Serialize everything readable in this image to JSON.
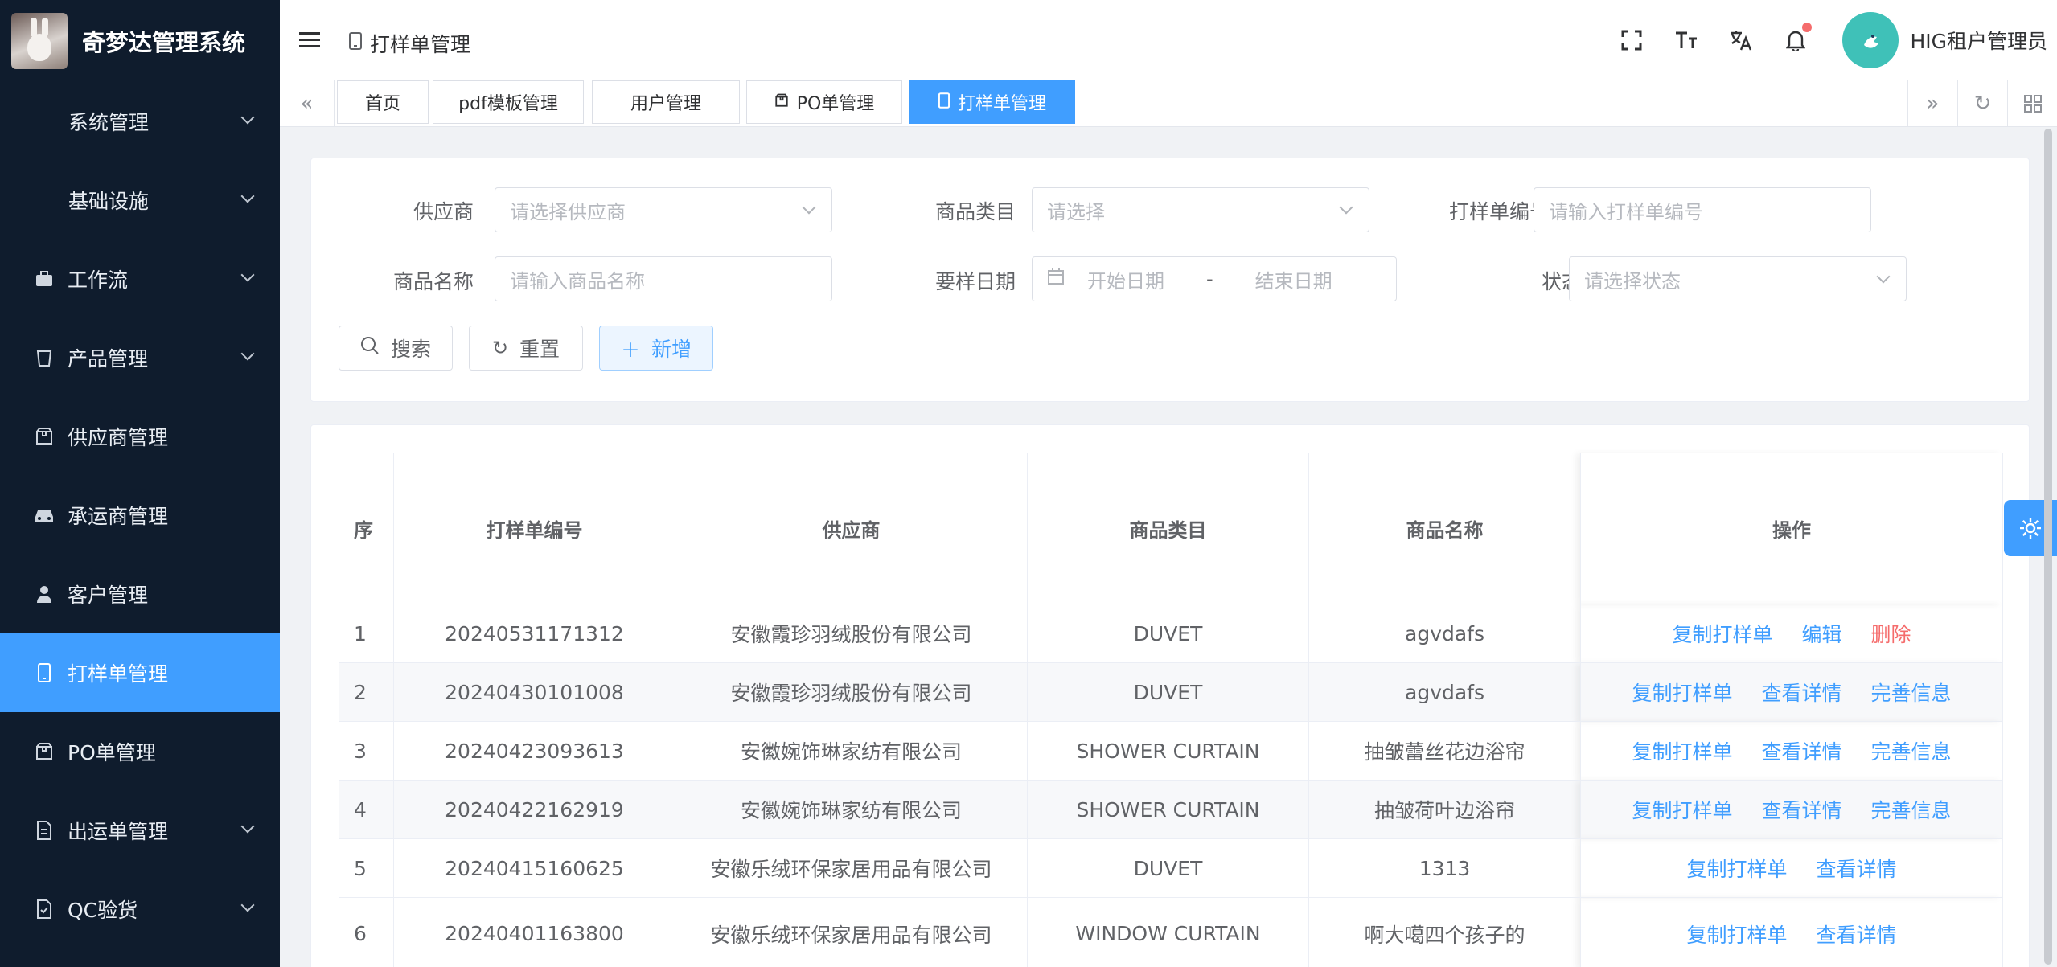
{
  "app": {
    "title": "奇梦达管理系统"
  },
  "sidebar": {
    "items": [
      {
        "label": "系统管理",
        "icon": "",
        "has_arrow": true
      },
      {
        "label": "基础设施",
        "icon": "",
        "has_arrow": true
      },
      {
        "label": "工作流",
        "icon": "briefcase-icon",
        "has_arrow": true
      },
      {
        "label": "产品管理",
        "icon": "cup-icon",
        "has_arrow": true
      },
      {
        "label": "供应商管理",
        "icon": "box-icon",
        "has_arrow": false
      },
      {
        "label": "承运商管理",
        "icon": "car-icon",
        "has_arrow": false
      },
      {
        "label": "客户管理",
        "icon": "user-icon",
        "has_arrow": false
      },
      {
        "label": "打样单管理",
        "icon": "phone-icon",
        "has_arrow": false,
        "active": true
      },
      {
        "label": "PO单管理",
        "icon": "box-icon",
        "has_arrow": false
      },
      {
        "label": "出运单管理",
        "icon": "document-icon",
        "has_arrow": true
      },
      {
        "label": "QC验货",
        "icon": "check-doc-icon",
        "has_arrow": true
      }
    ]
  },
  "header": {
    "breadcrumb": "打样单管理",
    "user_name": "HIG租户管理员"
  },
  "tabs": [
    {
      "label": "首页"
    },
    {
      "label": "pdf模板管理"
    },
    {
      "label": "用户管理"
    },
    {
      "label": "PO单管理"
    },
    {
      "label": "打样单管理",
      "active": true
    }
  ],
  "search": {
    "supplier_label": "供应商",
    "supplier_placeholder": "请选择供应商",
    "category_label": "商品类目",
    "category_placeholder": "请选择",
    "order_no_label": "打样单编号",
    "order_no_placeholder": "请输入打样单编号",
    "product_name_label": "商品名称",
    "product_name_placeholder": "请输入商品名称",
    "sample_date_label": "要样日期",
    "start_date_placeholder": "开始日期",
    "date_separator": "-",
    "end_date_placeholder": "结束日期",
    "status_label": "状态",
    "status_placeholder": "请选择状态",
    "search_button": "搜索",
    "reset_button": "重置",
    "add_button": "新增"
  },
  "table": {
    "columns": [
      "序",
      "打样单编号",
      "供应商",
      "商品类目",
      "商品名称",
      "操作"
    ],
    "rows": [
      {
        "idx": "1",
        "order_no": "20240531171312",
        "supplier": "安徽霞珍羽绒股份有限公司",
        "category": "DUVET",
        "product": "agvdafs",
        "actions": [
          {
            "label": "复制打样单",
            "type": "link"
          },
          {
            "label": "编辑",
            "type": "link"
          },
          {
            "label": "删除",
            "type": "danger"
          }
        ]
      },
      {
        "idx": "2",
        "order_no": "20240430101008",
        "supplier": "安徽霞珍羽绒股份有限公司",
        "category": "DUVET",
        "product": "agvdafs",
        "actions": [
          {
            "label": "复制打样单",
            "type": "link"
          },
          {
            "label": "查看详情",
            "type": "link"
          },
          {
            "label": "完善信息",
            "type": "link"
          }
        ]
      },
      {
        "idx": "3",
        "order_no": "20240423093613",
        "supplier": "安徽婉饰琳家纺有限公司",
        "category": "SHOWER CURTAIN",
        "product": "抽皱蕾丝花边浴帘",
        "actions": [
          {
            "label": "复制打样单",
            "type": "link"
          },
          {
            "label": "查看详情",
            "type": "link"
          },
          {
            "label": "完善信息",
            "type": "link"
          }
        ]
      },
      {
        "idx": "4",
        "order_no": "20240422162919",
        "supplier": "安徽婉饰琳家纺有限公司",
        "category": "SHOWER CURTAIN",
        "product": "抽皱荷叶边浴帘",
        "actions": [
          {
            "label": "复制打样单",
            "type": "link"
          },
          {
            "label": "查看详情",
            "type": "link"
          },
          {
            "label": "完善信息",
            "type": "link"
          }
        ]
      },
      {
        "idx": "5",
        "order_no": "20240415160625",
        "supplier": "安徽乐绒环保家居用品有限公司",
        "category": "DUVET",
        "product": "1313",
        "actions": [
          {
            "label": "复制打样单",
            "type": "link"
          },
          {
            "label": "查看详情",
            "type": "link"
          }
        ]
      },
      {
        "idx": "6",
        "order_no": "20240401163800",
        "supplier": "安徽乐绒环保家居用品有限公司",
        "category": "WINDOW CURTAIN",
        "product": "啊大噶四个孩子的",
        "actions": [
          {
            "label": "复制打样单",
            "type": "link"
          },
          {
            "label": "查看详情",
            "type": "link"
          }
        ]
      }
    ]
  },
  "colors": {
    "primary": "#409eff",
    "danger": "#f56c6c",
    "sidebar_bg": "#0f1c2d",
    "avatar": "#3fc1b8"
  }
}
